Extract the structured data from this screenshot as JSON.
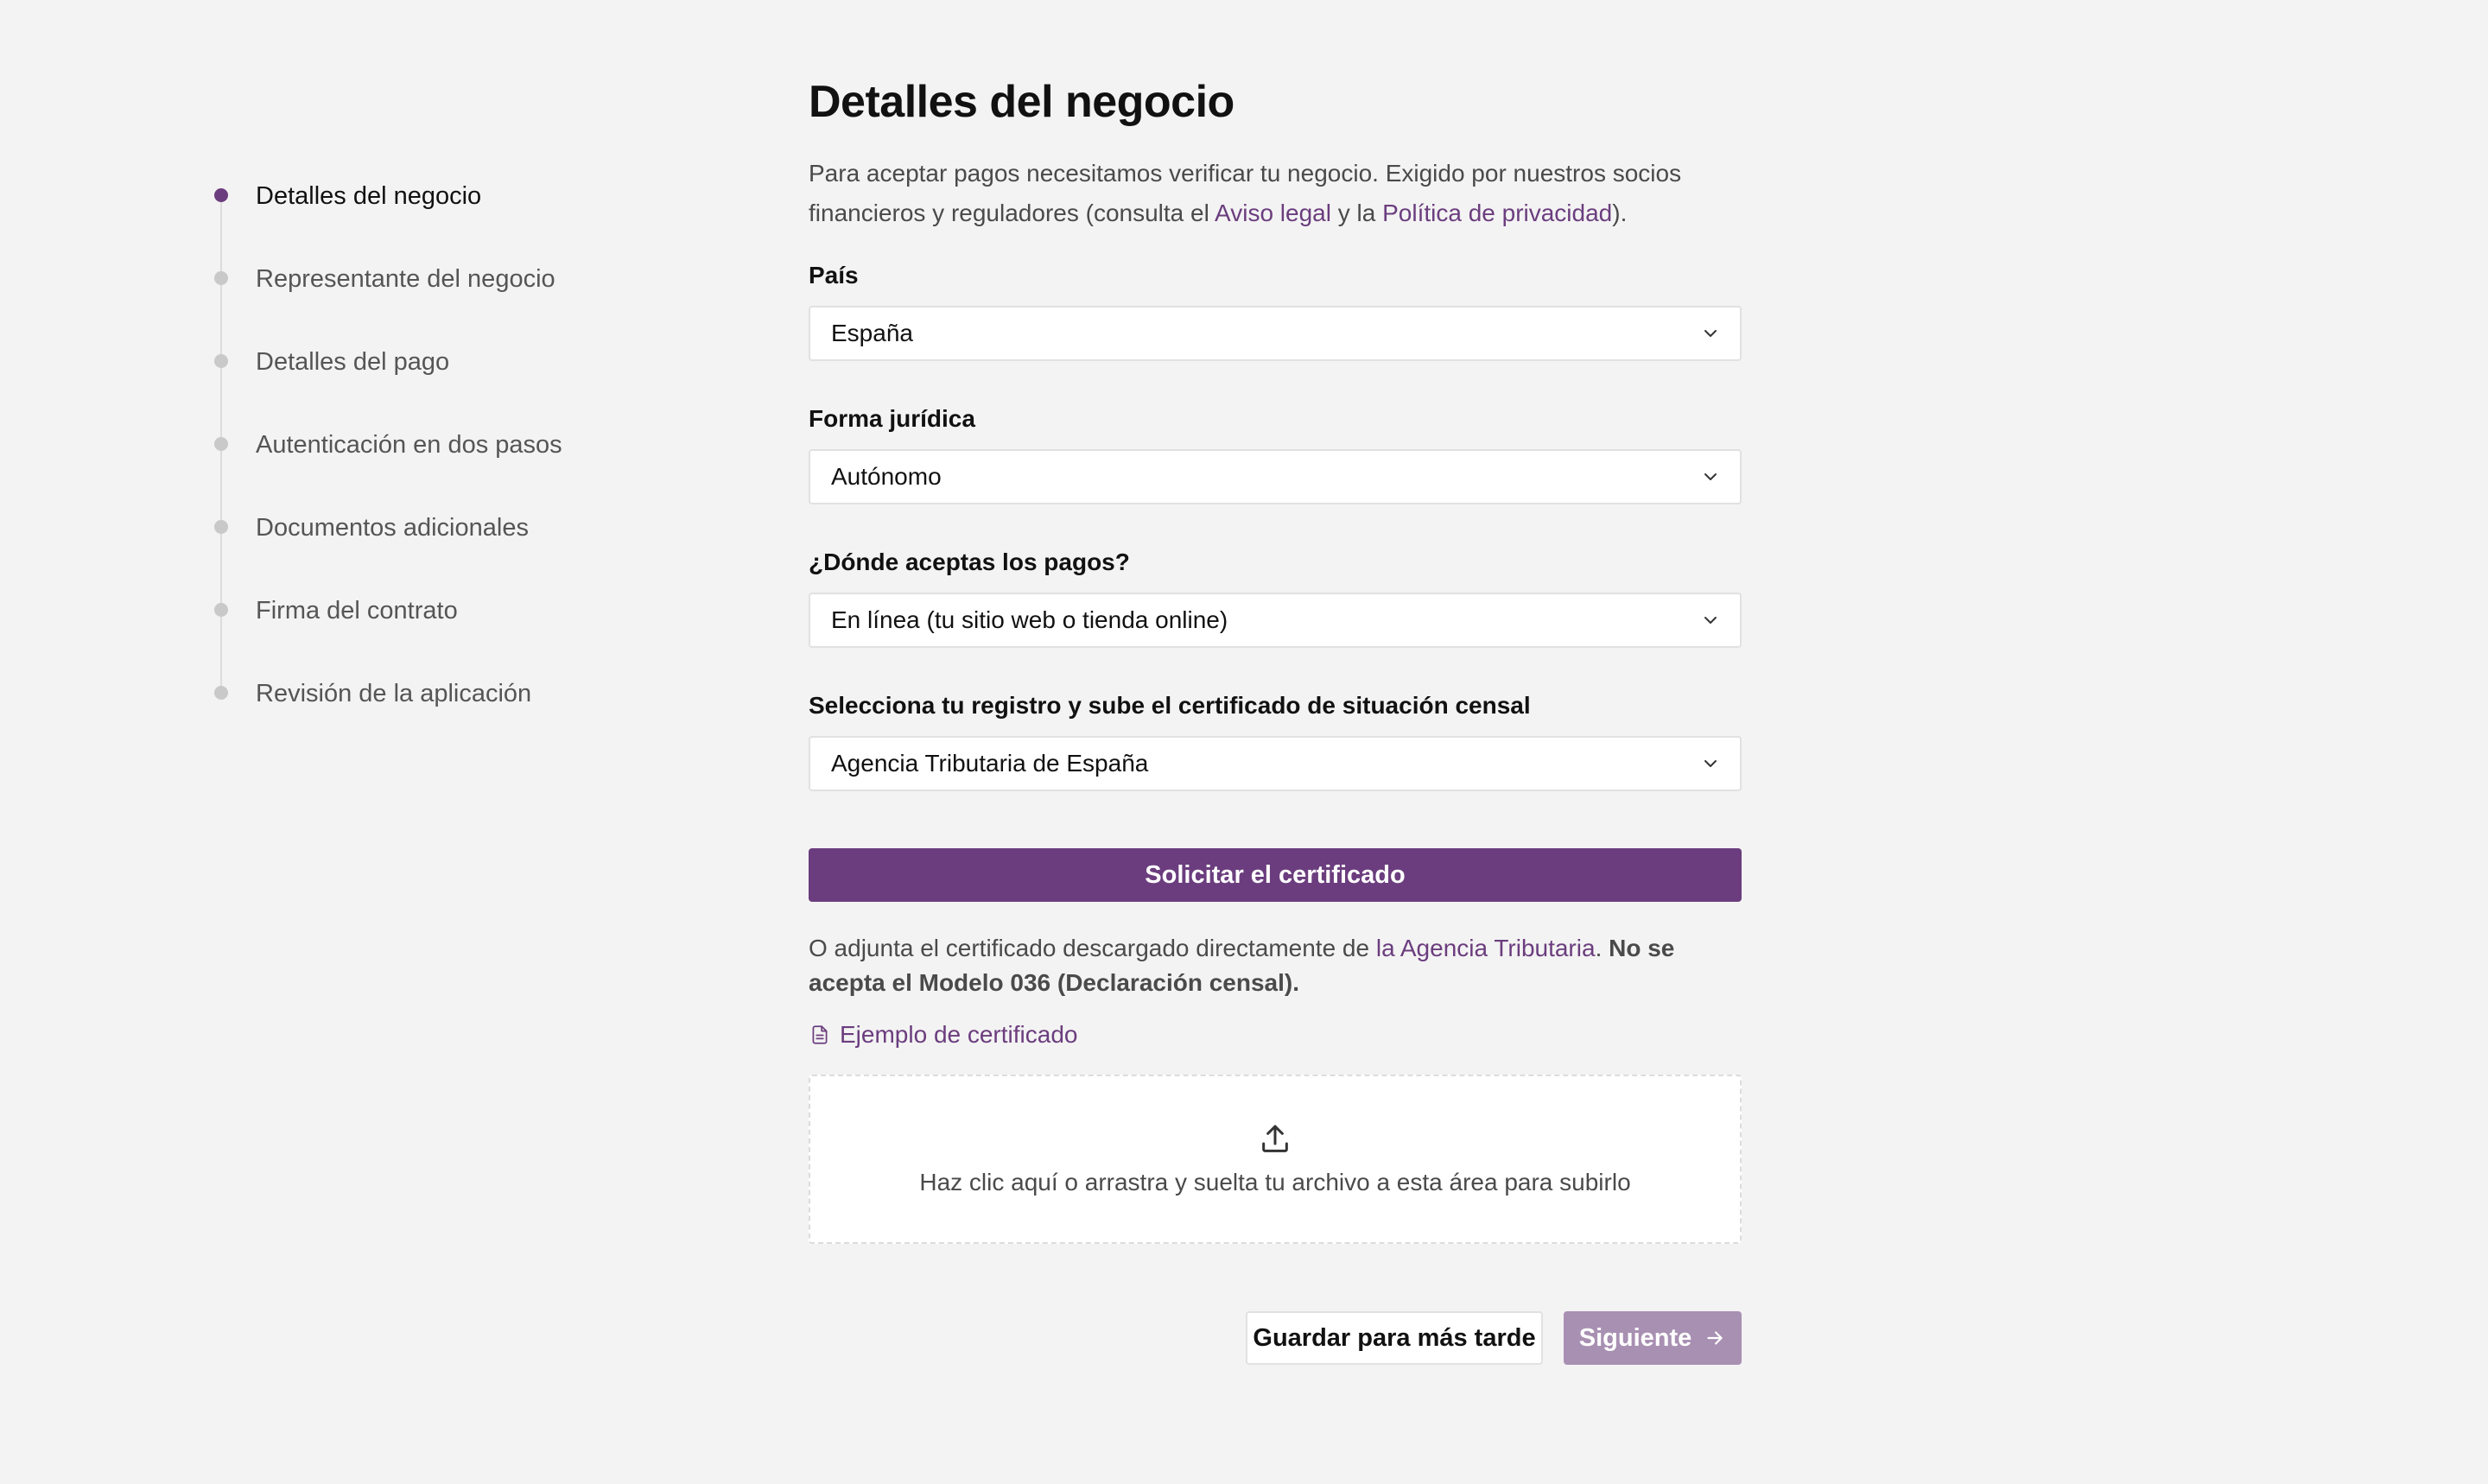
{
  "stepper": {
    "steps": [
      {
        "label": "Detalles del negocio",
        "active": true
      },
      {
        "label": "Representante del negocio",
        "active": false
      },
      {
        "label": "Detalles del pago",
        "active": false
      },
      {
        "label": "Autenticación en dos pasos",
        "active": false
      },
      {
        "label": "Documentos adicionales",
        "active": false
      },
      {
        "label": "Firma del contrato",
        "active": false
      },
      {
        "label": "Revisión de la aplicación",
        "active": false
      }
    ]
  },
  "main": {
    "title": "Detalles del negocio",
    "intro_prefix": "Para aceptar pagos necesitamos verificar tu negocio. Exigido por nuestros socios financieros y reguladores (consulta el ",
    "intro_link1": "Aviso legal",
    "intro_mid": " y la ",
    "intro_link2": "Política de privacidad",
    "intro_suffix": ")."
  },
  "fields": {
    "country": {
      "label": "País",
      "value": "España"
    },
    "legal_form": {
      "label": "Forma jurídica",
      "value": "Autónomo"
    },
    "payment_place": {
      "label": "¿Dónde aceptas los pagos?",
      "value": "En línea (tu sitio web o tienda online)"
    },
    "registry": {
      "label": "Selecciona tu registro y sube el certificado de situación censal",
      "value": "Agencia Tributaria de España"
    }
  },
  "certificate": {
    "request_button": "Solicitar el certificado",
    "note_prefix": "O adjunta el certificado descargado directamente de ",
    "note_link": "la Agencia Tributaria",
    "note_period": ". ",
    "note_bold": "No se acepta el Modelo 036 (Declaración censal).",
    "example_link": "Ejemplo de certificado",
    "dropzone_text": "Haz clic aquí o arrastra y suelta tu archivo a esta área para subirlo"
  },
  "footer": {
    "save_later": "Guardar para más tarde",
    "next": "Siguiente"
  },
  "colors": {
    "accent": "#6b3d7e",
    "accent_disabled": "#a890b2",
    "background": "#f3f3f3"
  },
  "icons": {
    "select_chevron": "chevron-down-icon",
    "example": "document-icon",
    "upload": "upload-icon",
    "next": "arrow-right-icon"
  }
}
